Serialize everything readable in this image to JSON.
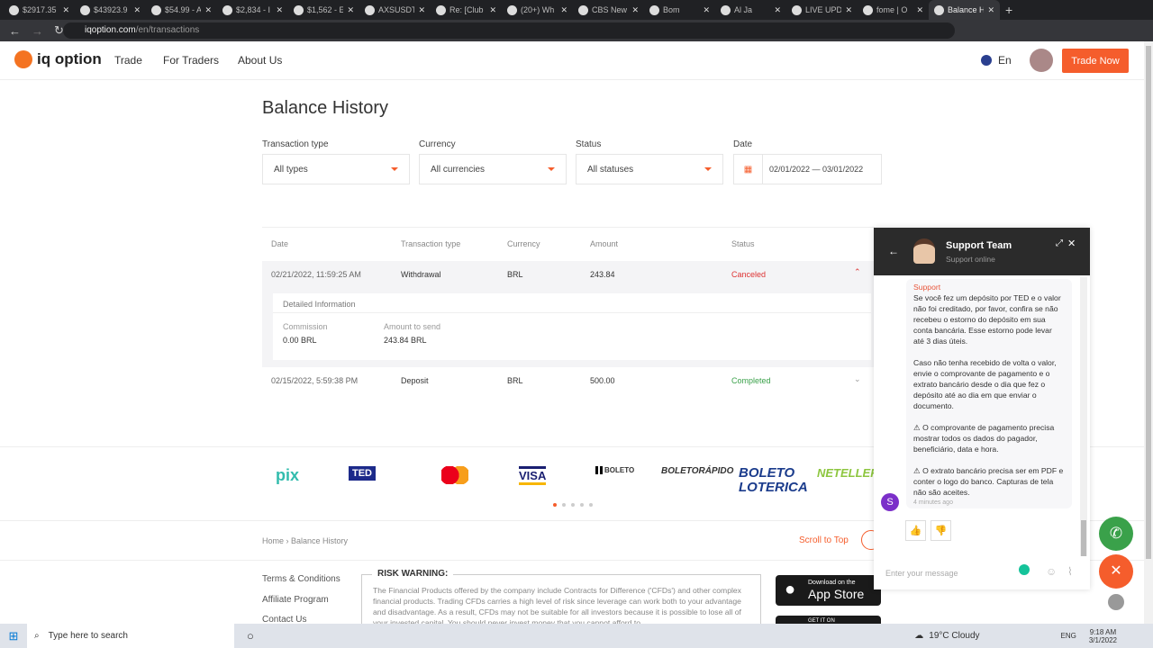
{
  "browser": {
    "tabs": [
      "$2917.35",
      "$43923.9",
      "$54.99 - A",
      "$2,834 - I",
      "$1,562 - E",
      "AXSUSDT",
      "Re: [Club",
      "(20+) Wh",
      "CBS New",
      "Bom",
      "Al Ja",
      "LIVE UPD",
      "fome | O",
      "Balance H"
    ],
    "url_domain": "iqoption.com",
    "url_path": "/en/transactions"
  },
  "header": {
    "logo": "iq option",
    "nav": [
      "Trade",
      "For Traders",
      "About Us"
    ],
    "lang": "En",
    "trade_now": "Trade Now"
  },
  "page": {
    "title": "Balance History",
    "filters": [
      {
        "label": "Transaction type",
        "value": "All types"
      },
      {
        "label": "Currency",
        "value": "All currencies"
      },
      {
        "label": "Status",
        "value": "All statuses"
      },
      {
        "label": "Date",
        "value": "02/01/2022 — 03/01/2022"
      }
    ],
    "columns": [
      "Date",
      "Transaction type",
      "Currency",
      "Amount",
      "Status"
    ],
    "rows": [
      {
        "date": "02/21/2022, 11:59:25 AM",
        "type": "Withdrawal",
        "currency": "BRL",
        "amount": "243.84",
        "status": "Canceled"
      },
      {
        "date": "02/15/2022, 5:59:38 PM",
        "type": "Deposit",
        "currency": "BRL",
        "amount": "500.00",
        "status": "Completed"
      }
    ],
    "details": {
      "title": "Detailed Information",
      "commission_label": "Commission",
      "commission": "0.00 BRL",
      "send_label": "Amount to send",
      "send": "243.84 BRL"
    }
  },
  "payments": [
    "pix",
    "TED",
    "VISA",
    "BOLETO",
    "BOLETORÁPIDO",
    "BOLETO LOTERICA",
    "NETELLER"
  ],
  "footer": {
    "breadcrumb": [
      "Home",
      "Balance History"
    ],
    "scroll_top": "Scroll to Top",
    "links": [
      "Terms & Conditions",
      "Affiliate Program",
      "Contact Us"
    ],
    "risk_title": "RISK WARNING:",
    "risk_text": "The Financial Products offered by the company include Contracts for Difference ('CFDs') and other complex financial products. Trading CFDs carries a high level of risk since leverage can work both to your advantage and disadvantage. As a result, CFDs may not be suitable for all investors because it is possible to lose all of your invested capital. You should never invest money that you cannot afford to",
    "appstore_small": "Download on the",
    "appstore": "App Store",
    "gplay_small": "GET IT ON"
  },
  "chat": {
    "title": "Support Team",
    "subtitle": "Support online",
    "sender": "Support",
    "message": "Se você fez um depósito por TED e o valor não foi creditado, por favor, confira se não recebeu o estorno do depósito em sua conta bancária. Esse estorno pode levar até 3 dias úteis.\n\nCaso não tenha recebido de volta o valor, envie o comprovante de pagamento e o extrato bancário desde o dia que fez o depósito até ao dia em que enviar o documento.\n\n⚠ O comprovante de pagamento precisa mostrar todos os dados do pagador, beneficiário, data e hora.\n\n⚠ O extrato bancário precisa ser em PDF e conter o logo do banco. Capturas de tela não são aceites.",
    "time": "4 minutes ago",
    "avatar": "S",
    "placeholder": "Enter your message"
  },
  "taskbar": {
    "search": "Type here to search",
    "weather": "19°C Cloudy",
    "lang": "ENG",
    "time": "9:18 AM",
    "date": "3/1/2022"
  },
  "colors": {
    "accent": "#f55d2c",
    "green": "#3aa14a"
  }
}
